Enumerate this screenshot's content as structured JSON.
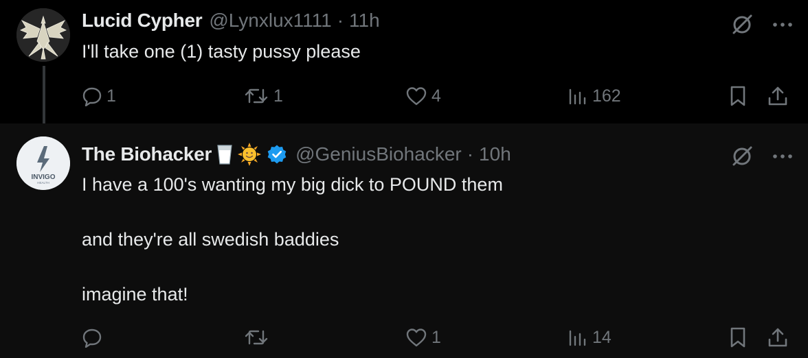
{
  "tweets": [
    {
      "author": {
        "name": "Lucid Cypher",
        "handle": "@Lynxlux1111",
        "separator": "·",
        "time": "11h"
      },
      "text": "I'll take one (1) tasty pussy please",
      "stats": {
        "replies": "1",
        "retweets": "1",
        "likes": "4",
        "views": "162"
      }
    },
    {
      "author": {
        "name": "The Biohacker",
        "name_emojis": [
          "milk-glass-emoji",
          "sun-face-emoji"
        ],
        "verified": true,
        "handle": "@GeniusBiohacker",
        "separator": "·",
        "time": "10h",
        "avatar_text": "INVIGO",
        "avatar_subtext": "HEALTH"
      },
      "text_paragraphs": [
        "I have a 100's wanting my big dick to POUND them",
        "and they're all swedish baddies",
        "imagine that!"
      ],
      "stats": {
        "replies": "",
        "retweets": "",
        "likes": "1",
        "views": "14"
      }
    }
  ],
  "icons": {
    "grok": "grok-slash-circle-icon",
    "more": "more-dots-icon",
    "reply": "reply-bubble-icon",
    "retweet": "retweet-arrows-icon",
    "like": "heart-icon",
    "views": "views-bars-icon",
    "bookmark": "bookmark-icon",
    "share": "share-upload-icon"
  },
  "colors": {
    "background": "#000000",
    "text": "#e7e9ea",
    "secondary": "#71767b",
    "verified": "#1d9bf0",
    "thread_line": "#333639"
  }
}
